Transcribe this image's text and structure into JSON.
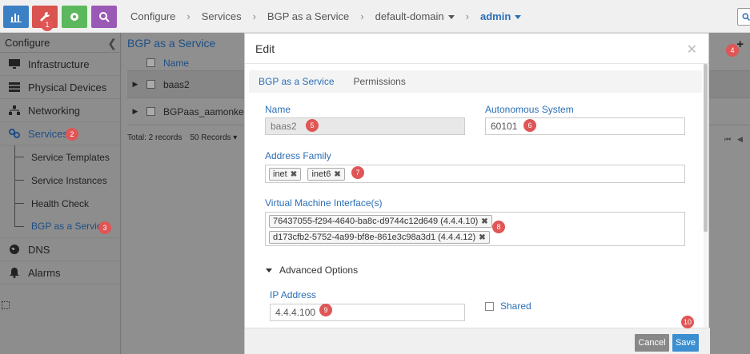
{
  "breadcrumb": {
    "items": [
      "Configure",
      "Services",
      "BGP as a Service",
      "default-domain",
      "admin"
    ]
  },
  "sidebar": {
    "title": "Configure",
    "items": [
      {
        "label": "Infrastructure",
        "icon": "monitor-icon"
      },
      {
        "label": "Physical Devices",
        "icon": "server-icon"
      },
      {
        "label": "Networking",
        "icon": "network-icon"
      },
      {
        "label": "Services",
        "icon": "link-icon"
      },
      {
        "label": "Service Templates"
      },
      {
        "label": "Service Instances"
      },
      {
        "label": "Health Check"
      },
      {
        "label": "BGP as a Service"
      },
      {
        "label": "DNS",
        "icon": "globe-icon"
      },
      {
        "label": "Alarms",
        "icon": "bell-icon"
      }
    ]
  },
  "content": {
    "title": "BGP as a Service",
    "column_name": "Name",
    "rows": [
      "baas2",
      "BGPaas_aamonker"
    ],
    "total": "Total: 2 records",
    "page_size": "50 Records"
  },
  "modal": {
    "title": "Edit",
    "tabs": [
      "BGP as a Service",
      "Permissions"
    ],
    "name_label": "Name",
    "name_value": "baas2",
    "as_label": "Autonomous System",
    "as_value": "60101",
    "af_label": "Address Family",
    "af_tags": [
      "inet",
      "inet6"
    ],
    "vmi_label": "Virtual Machine Interface(s)",
    "vmi_tags": [
      "76437055-f294-4640-ba8c-d9744c12d649 (4.4.4.10)",
      "d173cfb2-5752-4a99-bf8e-861e3c98a3d1 (4.4.4.12)"
    ],
    "advanced_label": "Advanced Options",
    "ip_label": "IP Address",
    "ip_value": "4.4.4.100",
    "shared_label": "Shared",
    "cancel_label": "Cancel",
    "save_label": "Save"
  },
  "badges": [
    "1",
    "2",
    "3",
    "4",
    "5",
    "6",
    "7",
    "8",
    "9",
    "10"
  ],
  "colors": {
    "accent": "#2b6fb6",
    "badge": "#e05555",
    "monitor_tab": "#3b7fc4",
    "config_tab": "#d9534f",
    "settings_tab": "#5cb85c",
    "query_tab": "#9b59b6",
    "save_button": "#3b8fd0",
    "cancel_button": "#888888"
  }
}
